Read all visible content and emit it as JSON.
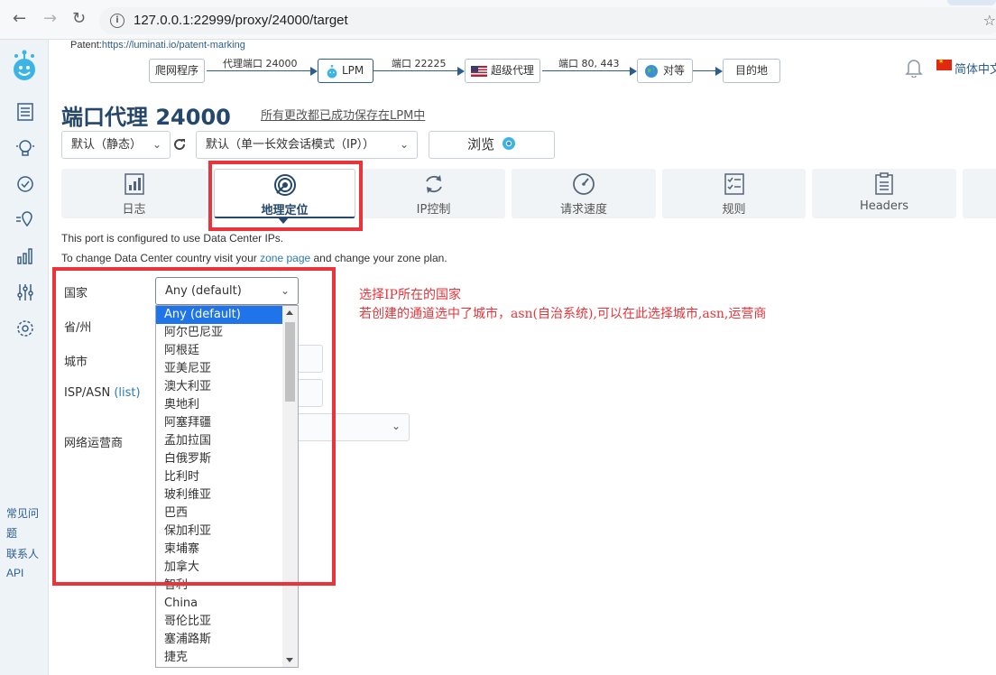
{
  "browser": {
    "url": "127.0.0.1:22999/proxy/24000/target",
    "info_icon": "i"
  },
  "patent": {
    "label": "Patent:",
    "link": "https://luminati.io/patent-marking"
  },
  "pipeline": {
    "crawler": "爬网程序",
    "port_label_1": "代理端口 24000",
    "lpm": "LPM",
    "port_label_2": "端口 22225",
    "super_proxy": "超级代理",
    "port_label_3": "端口 80, 443",
    "peer": "对等",
    "destination": "目的地"
  },
  "header": {
    "language": "简体中文"
  },
  "page": {
    "title": "端口代理 24000",
    "saved_note": "所有更改都已成功保存在LPM中"
  },
  "controls": {
    "preset_select": "默认（静态）",
    "session_select": "默认（单一长效会话模式（IP））",
    "browse_button": "浏览"
  },
  "tabs": [
    {
      "label": "日志",
      "icon": "logs-icon"
    },
    {
      "label": "地理定位",
      "icon": "geolocation-icon"
    },
    {
      "label": "IP控制",
      "icon": "ip-control-icon"
    },
    {
      "label": "请求速度",
      "icon": "request-speed-icon"
    },
    {
      "label": "规则",
      "icon": "rules-icon"
    },
    {
      "label": "Headers",
      "icon": "headers-icon"
    }
  ],
  "info": {
    "line1": "This port is configured to use Data Center IPs.",
    "line2_before": "To change Data Center country visit your ",
    "line2_link": "zone page",
    "line2_after": " and change your zone plan."
  },
  "form": {
    "country_label": "国家",
    "country_value": "Any (default)",
    "state_label": "省/州",
    "city_label": "城市",
    "asn_label": "ISP/ASN",
    "asn_link": "(list)",
    "carrier_label": "网络运营商"
  },
  "country_options": [
    "Any (default)",
    "阿尔巴尼亚",
    "阿根廷",
    "亚美尼亚",
    "澳大利亚",
    "奥地利",
    "阿塞拜疆",
    "孟加拉国",
    "白俄罗斯",
    "比利时",
    "玻利维亚",
    "巴西",
    "保加利亚",
    "柬埔寨",
    "加拿大",
    "智利",
    "China",
    "哥伦比亚",
    "塞浦路斯",
    "捷克"
  ],
  "sidebar_links": {
    "faq": "常见问题",
    "contact": "联系人",
    "api": "API"
  },
  "annotations": {
    "line1": "选择IP所在的国家",
    "line2": "若创建的通道选中了城市，asn(自治系统),可以在此选择城市,asn,运营商"
  },
  "colors": {
    "accent": "#24476b",
    "link": "#2b79b5",
    "highlight": "#e8343a",
    "selected_option": "#1e74e8"
  }
}
